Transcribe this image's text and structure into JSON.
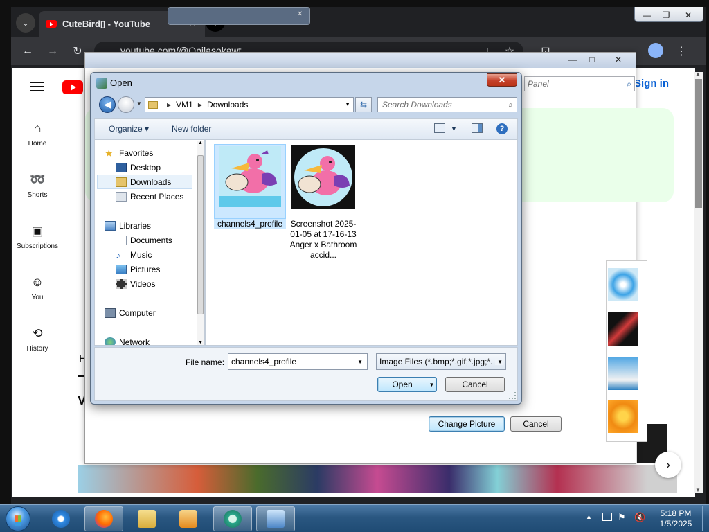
{
  "browser": {
    "tab_title": "CuteBird▯ - YouTube",
    "tab_close": "×",
    "new_tab": "+",
    "tab_search": "⌄",
    "url": "youtube.com/@Opilasokawt",
    "back": "←",
    "forward": "→",
    "reload": "↻",
    "menu": "⋮",
    "bookmark": "☆",
    "extensions": "⊡",
    "minimize": "—",
    "restore": "❐",
    "close": "✕"
  },
  "youtube": {
    "sign_in": "Sign in",
    "sidebar": [
      {
        "icon": "⌂",
        "label": "Home"
      },
      {
        "icon": "➿",
        "label": "Shorts"
      },
      {
        "icon": "▣",
        "label": "Subscriptions"
      },
      {
        "icon": "☺",
        "label": "You"
      },
      {
        "icon": "⟲",
        "label": "History"
      }
    ],
    "peek_h": "H",
    "peek_v": "V",
    "next_arrow": "›"
  },
  "panel": {
    "search_placeholder": "Panel",
    "change_picture": "Change Picture",
    "cancel": "Cancel",
    "minimize": "—",
    "maximize": "□",
    "close": "✕"
  },
  "dialog": {
    "title": "Open",
    "close": "✕",
    "breadcrumb": [
      "VM1",
      "Downloads"
    ],
    "search_placeholder": "Search Downloads",
    "organize": "Organize ▾",
    "new_folder": "New folder",
    "nav": {
      "favorites": "Favorites",
      "desktop": "Desktop",
      "downloads": "Downloads",
      "recent": "Recent Places",
      "libraries": "Libraries",
      "documents": "Documents",
      "music": "Music",
      "pictures": "Pictures",
      "videos": "Videos",
      "computer": "Computer",
      "network": "Network"
    },
    "files": [
      {
        "name": "channels4_profile"
      },
      {
        "name": "Screenshot 2025-01-05 at 17-16-13 Anger x Bathroom accid..."
      }
    ],
    "file_name_label": "File name:",
    "file_name_value": "channels4_profile",
    "filter_value": "Image Files (*.bmp;*.gif;*.jpg;*.",
    "open_button": "Open",
    "cancel_button": "Cancel"
  },
  "taskbar": {
    "time": "5:18 PM",
    "date": "1/5/2025"
  },
  "colors": {
    "chrome_dark": "#202124",
    "yt_red": "#ff0000",
    "win7_blue": "#1f4b74",
    "selection": "#cce8ff"
  }
}
